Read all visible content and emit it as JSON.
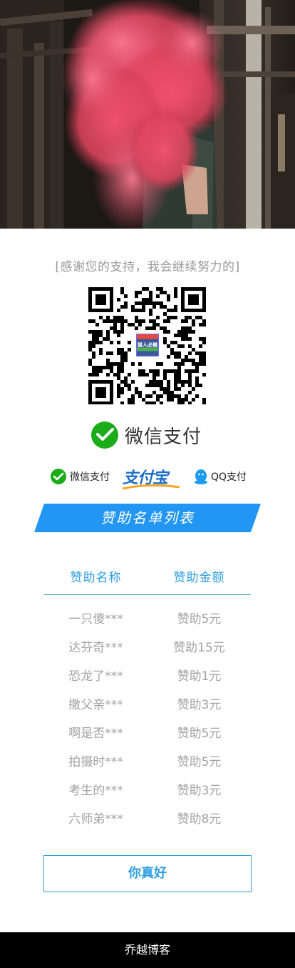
{
  "hero": {
    "icon": "photo-red-smoke-person"
  },
  "thanks_text": "[感谢您的支持，我会继续努力的]",
  "qr": {
    "icon": "qr-code",
    "badge_text": "猫人必備"
  },
  "wechat_pay": {
    "icon": "wechat-pay-icon",
    "label": "微信支付",
    "color": "#1aad19"
  },
  "payment_methods": [
    {
      "icon": "wechat-icon",
      "label": "微信支付"
    },
    {
      "icon": "alipay-logo",
      "label": "支付宝"
    },
    {
      "icon": "qq-icon",
      "label": "QQ支付"
    }
  ],
  "banner": {
    "title": "赞助名单列表",
    "color": "#2196f3"
  },
  "sponsor_table": {
    "headers": [
      "赞助名称",
      "赞助金额"
    ],
    "rows": [
      {
        "name": "一只傻***",
        "amount": "赞助5元"
      },
      {
        "name": "达芬奇***",
        "amount": "赞助15元"
      },
      {
        "name": "恐龙了***",
        "amount": "赞助1元"
      },
      {
        "name": "撒父亲***",
        "amount": "赞助3元"
      },
      {
        "name": "啊是否***",
        "amount": "赞助5元"
      },
      {
        "name": "拍摄时***",
        "amount": "赞助5元"
      },
      {
        "name": "考生的***",
        "amount": "赞助3元"
      },
      {
        "name": "六师弟***",
        "amount": "赞助8元"
      }
    ]
  },
  "action_button": {
    "label": "你真好"
  },
  "footer": {
    "text": "乔越博客"
  },
  "colors": {
    "accent": "#2f9fe0",
    "text_muted": "#a3a3a3",
    "footer_bg": "#000000"
  }
}
